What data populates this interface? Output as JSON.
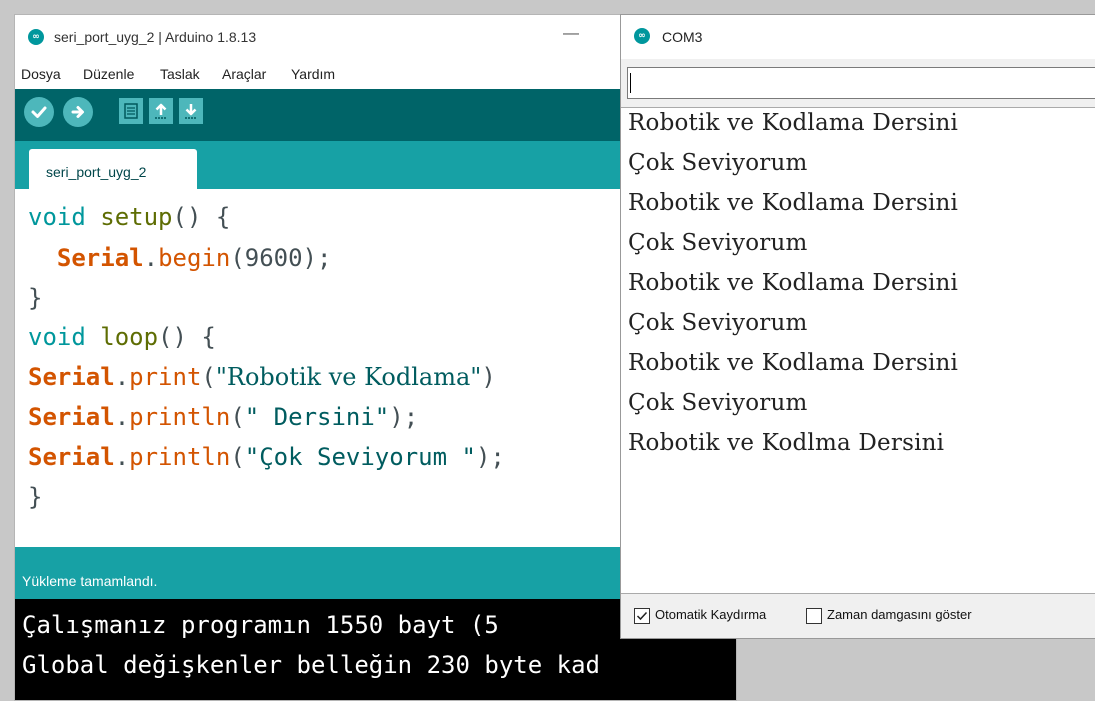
{
  "ide": {
    "title": "seri_port_uyg_2 | Arduino 1.8.13",
    "minimize": "—",
    "logo_icon": "arduino-logo-icon",
    "menu": [
      "Dosya",
      "Düzenle",
      "Taslak",
      "Araçlar",
      "Yardım"
    ],
    "toolbar": [
      {
        "name": "verify",
        "icon": "checkmark-icon"
      },
      {
        "name": "upload",
        "icon": "arrow-right-icon"
      },
      {
        "name": "new",
        "icon": "new-file-icon"
      },
      {
        "name": "open",
        "icon": "open-arrow-up-icon"
      },
      {
        "name": "save",
        "icon": "save-arrow-down-icon"
      }
    ],
    "tab_label": "seri_port_uyg_2",
    "code": {
      "l1_type": "void",
      "l1_fn": "setup",
      "l1_rest": "() {",
      "l2_obj": "Serial",
      "l2_dot": ".",
      "l2_method": "begin",
      "l2_rest": "(9600);",
      "l3": "}",
      "l4_type": "void",
      "l4_fn": "loop",
      "l4_rest": "() {",
      "l5_obj": "Serial",
      "l5_dot": ".",
      "l5_method": "print",
      "l5_open": "(",
      "l5_str": "\"Robotik ve Kodlama\"",
      "l5_close": ")",
      "l6_obj": "Serial",
      "l6_dot": ".",
      "l6_method": "println",
      "l6_open": "(",
      "l6_str": "\" Dersini\"",
      "l6_close": ");",
      "l7_obj": "Serial",
      "l7_dot": ".",
      "l7_method": "println",
      "l7_open": "(",
      "l7_str": "\"Çok Seviyorum \"",
      "l7_close": ");",
      "l8": "}"
    },
    "status": "Yükleme tamamlandı.",
    "console": [
      "Çalışmanız programın 1550 bayt (5",
      "Global değişkenler belleğin 230 byte kad"
    ],
    "colors": {
      "toolbar": "#006468",
      "accent": "#17a1a5",
      "button": "#4db7bb"
    }
  },
  "monitor": {
    "title": "COM3",
    "logo_icon": "arduino-logo-icon",
    "input_value": "",
    "output": [
      "Robotik ve Kodlama Dersini",
      "Çok Seviyorum",
      "Robotik ve Kodlama Dersini",
      "Çok Seviyorum",
      "Robotik ve Kodlama Dersini",
      "Çok Seviyorum",
      "Robotik ve Kodlama Dersini",
      "Çok Seviyorum",
      "Robotik ve Kodlma Dersini"
    ],
    "autoscroll": {
      "label": "Otomatik Kaydırma",
      "checked": true
    },
    "timestamp": {
      "label": "Zaman damgasını göster",
      "checked": false
    }
  }
}
